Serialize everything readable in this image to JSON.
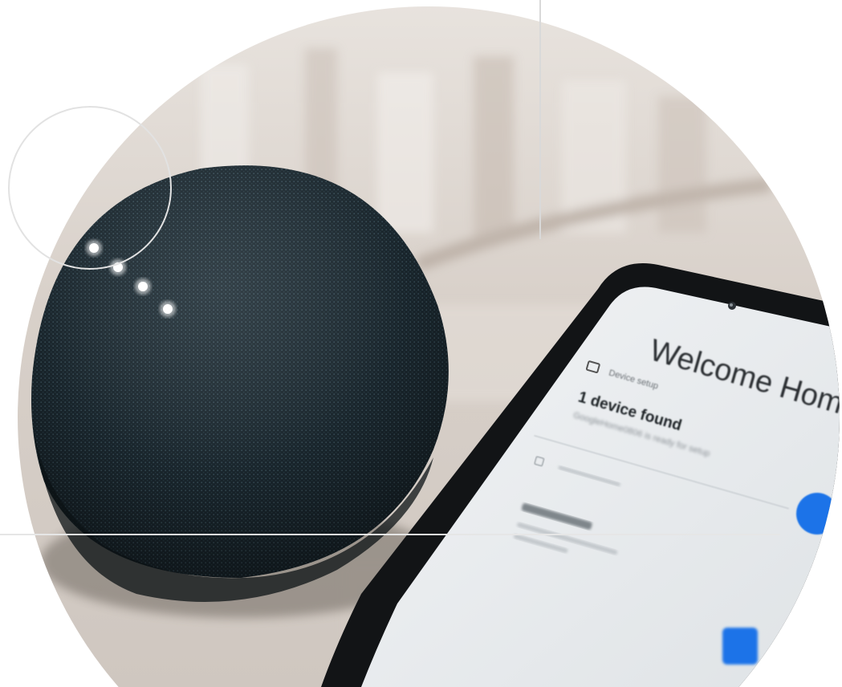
{
  "phone_screen": {
    "title": "Welcome Home",
    "section_label": "Device setup",
    "devices_found": "1 device found",
    "device_detail": "GoogleHome0806 is ready for setup"
  },
  "colors": {
    "speaker_fabric": "#1d2b33",
    "phone_body": "#141618",
    "screen_bg": "#eef1f3",
    "accent_blue": "#1a73e8",
    "carpet": "#d9d3cc",
    "deco_lines": "#d9d9d9"
  }
}
